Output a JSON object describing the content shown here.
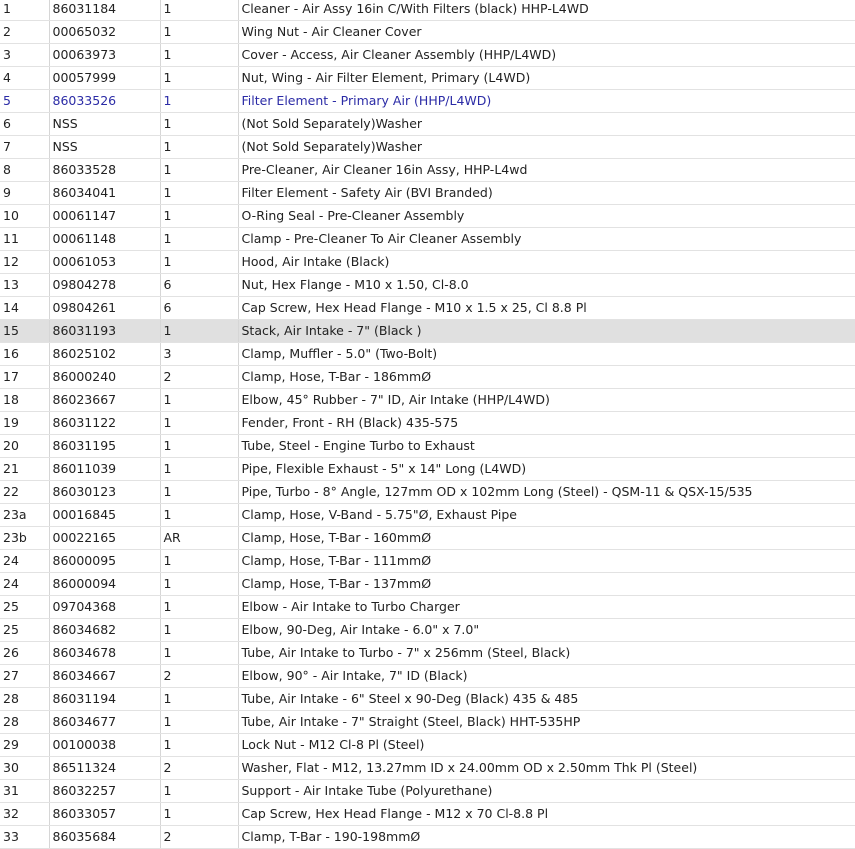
{
  "parts_table": {
    "rows": [
      {
        "ref": "1",
        "part_no": "86031184",
        "qty": "1",
        "description": "Cleaner - Air Assy 16in C/With Filters (black) HHP-L4WD",
        "state": ""
      },
      {
        "ref": "2",
        "part_no": "00065032",
        "qty": "1",
        "description": "Wing Nut - Air Cleaner Cover",
        "state": ""
      },
      {
        "ref": "3",
        "part_no": "00063973",
        "qty": "1",
        "description": "Cover - Access, Air Cleaner Assembly (HHP/L4WD)",
        "state": ""
      },
      {
        "ref": "4",
        "part_no": "00057999",
        "qty": "1",
        "description": "Nut, Wing - Air Filter Element, Primary (L4WD)",
        "state": ""
      },
      {
        "ref": "5",
        "part_no": "86033526",
        "qty": "1",
        "description": "Filter Element - Primary Air (HHP/L4WD)",
        "state": "link"
      },
      {
        "ref": "6",
        "part_no": "NSS",
        "qty": "1",
        "description": "(Not Sold Separately)Washer",
        "state": ""
      },
      {
        "ref": "7",
        "part_no": "NSS",
        "qty": "1",
        "description": "(Not Sold Separately)Washer",
        "state": ""
      },
      {
        "ref": "8",
        "part_no": "86033528",
        "qty": "1",
        "description": "Pre-Cleaner, Air Cleaner 16in Assy, HHP-L4wd",
        "state": ""
      },
      {
        "ref": "9",
        "part_no": "86034041",
        "qty": "1",
        "description": "Filter Element - Safety Air (BVI Branded)",
        "state": ""
      },
      {
        "ref": "10",
        "part_no": "00061147",
        "qty": "1",
        "description": "O-Ring Seal - Pre-Cleaner Assembly",
        "state": ""
      },
      {
        "ref": "11",
        "part_no": "00061148",
        "qty": "1",
        "description": "Clamp - Pre-Cleaner To Air Cleaner Assembly",
        "state": ""
      },
      {
        "ref": "12",
        "part_no": "00061053",
        "qty": "1",
        "description": "Hood, Air Intake (Black)",
        "state": ""
      },
      {
        "ref": "13",
        "part_no": "09804278",
        "qty": "6",
        "description": "Nut, Hex Flange - M10 x 1.50, Cl-8.0",
        "state": ""
      },
      {
        "ref": "14",
        "part_no": "09804261",
        "qty": "6",
        "description": "Cap Screw, Hex Head Flange - M10 x 1.5 x 25, Cl 8.8 Pl",
        "state": ""
      },
      {
        "ref": "15",
        "part_no": "86031193",
        "qty": "1",
        "description": "Stack, Air Intake - 7\" (Black )",
        "state": "hover"
      },
      {
        "ref": "16",
        "part_no": "86025102",
        "qty": "3",
        "description": "Clamp, Muffler - 5.0\" (Two-Bolt)",
        "state": ""
      },
      {
        "ref": "17",
        "part_no": "86000240",
        "qty": "2",
        "description": "Clamp, Hose, T-Bar - 186mmØ",
        "state": ""
      },
      {
        "ref": "18",
        "part_no": "86023667",
        "qty": "1",
        "description": "Elbow, 45° Rubber - 7\" ID, Air Intake (HHP/L4WD)",
        "state": ""
      },
      {
        "ref": "19",
        "part_no": "86031122",
        "qty": "1",
        "description": "Fender, Front - RH (Black) 435-575",
        "state": ""
      },
      {
        "ref": "20",
        "part_no": "86031195",
        "qty": "1",
        "description": "Tube, Steel - Engine Turbo to Exhaust",
        "state": ""
      },
      {
        "ref": "21",
        "part_no": "86011039",
        "qty": "1",
        "description": "Pipe, Flexible Exhaust - 5\" x 14\" Long (L4WD)",
        "state": ""
      },
      {
        "ref": "22",
        "part_no": "86030123",
        "qty": "1",
        "description": "Pipe, Turbo - 8° Angle, 127mm OD x 102mm Long (Steel) - QSM-11 & QSX-15/535",
        "state": ""
      },
      {
        "ref": "23a",
        "part_no": "00016845",
        "qty": "1",
        "description": "Clamp, Hose, V-Band - 5.75\"Ø, Exhaust Pipe",
        "state": ""
      },
      {
        "ref": "23b",
        "part_no": "00022165",
        "qty": "AR",
        "description": "Clamp, Hose, T-Bar - 160mmØ",
        "state": ""
      },
      {
        "ref": "24",
        "part_no": "86000095",
        "qty": "1",
        "description": "Clamp, Hose, T-Bar - 111mmØ",
        "state": ""
      },
      {
        "ref": "24",
        "part_no": "86000094",
        "qty": "1",
        "description": "Clamp, Hose, T-Bar - 137mmØ",
        "state": ""
      },
      {
        "ref": "25",
        "part_no": "09704368",
        "qty": "1",
        "description": "Elbow - Air Intake to Turbo Charger",
        "state": ""
      },
      {
        "ref": "25",
        "part_no": "86034682",
        "qty": "1",
        "description": "Elbow, 90-Deg, Air Intake - 6.0\" x 7.0\"",
        "state": ""
      },
      {
        "ref": "26",
        "part_no": "86034678",
        "qty": "1",
        "description": "Tube, Air Intake to Turbo - 7\" x 256mm (Steel, Black)",
        "state": ""
      },
      {
        "ref": "27",
        "part_no": "86034667",
        "qty": "2",
        "description": "Elbow, 90° - Air Intake, 7\" ID (Black)",
        "state": ""
      },
      {
        "ref": "28",
        "part_no": "86031194",
        "qty": "1",
        "description": "Tube, Air Intake - 6\" Steel x 90-Deg (Black) 435 & 485",
        "state": ""
      },
      {
        "ref": "28",
        "part_no": "86034677",
        "qty": "1",
        "description": "Tube, Air Intake - 7\" Straight (Steel, Black) HHT-535HP",
        "state": ""
      },
      {
        "ref": "29",
        "part_no": "00100038",
        "qty": "1",
        "description": "Lock Nut - M12 Cl-8 Pl (Steel)",
        "state": ""
      },
      {
        "ref": "30",
        "part_no": "86511324",
        "qty": "2",
        "description": "Washer, Flat - M12, 13.27mm ID x 24.00mm OD x 2.50mm Thk Pl (Steel)",
        "state": ""
      },
      {
        "ref": "31",
        "part_no": "86032257",
        "qty": "1",
        "description": "Support - Air Intake Tube (Polyurethane)",
        "state": ""
      },
      {
        "ref": "32",
        "part_no": "86033057",
        "qty": "1",
        "description": "Cap Screw, Hex Head Flange - M12 x 70 Cl-8.8 Pl",
        "state": ""
      },
      {
        "ref": "33",
        "part_no": "86035684",
        "qty": "2",
        "description": "Clamp, T-Bar - 190-198mmØ",
        "state": ""
      }
    ]
  },
  "colors": {
    "link_text": "#2b2ba6",
    "hover_row_bg": "#e0e0e0",
    "grid_line": "#d6d6d6"
  }
}
